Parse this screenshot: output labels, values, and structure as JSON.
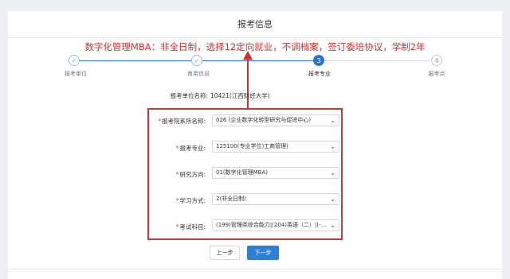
{
  "page_title": "报考信息",
  "annotation": "数字化管理MBA：非全日制，选择12定向就业，不调档案，签订委培协议，学制2年",
  "steps": [
    {
      "num": "✓",
      "label": "报考单位",
      "state": "done"
    },
    {
      "num": "✓",
      "label": "育用信息",
      "state": "done"
    },
    {
      "num": "3",
      "label": "报考专业",
      "state": "current"
    },
    {
      "num": "4",
      "label": "报考点",
      "state": "todo"
    }
  ],
  "unit": {
    "label": "报考单位名称:",
    "value": "10421(江西财经大学)"
  },
  "fields": [
    {
      "label": "报考院系所名称:",
      "value": "026 (企业数字化转型研究与促进中心)"
    },
    {
      "label": "报考专业:",
      "value": "125100(专业学位)工商管理)"
    },
    {
      "label": "研究方向:",
      "value": "01(数字化管理MBA)"
    },
    {
      "label": "学习方式:",
      "value": "2(非全日制)"
    },
    {
      "label": "考试科目:",
      "value": "(199)管理类综合能力|(204)英语（二）|(-..."
    }
  ],
  "buttons": {
    "prev": "上一步",
    "next": "下一步"
  },
  "colors": {
    "accent": "#2e75c9",
    "annotation": "#d0302b",
    "required": "#e04848"
  }
}
